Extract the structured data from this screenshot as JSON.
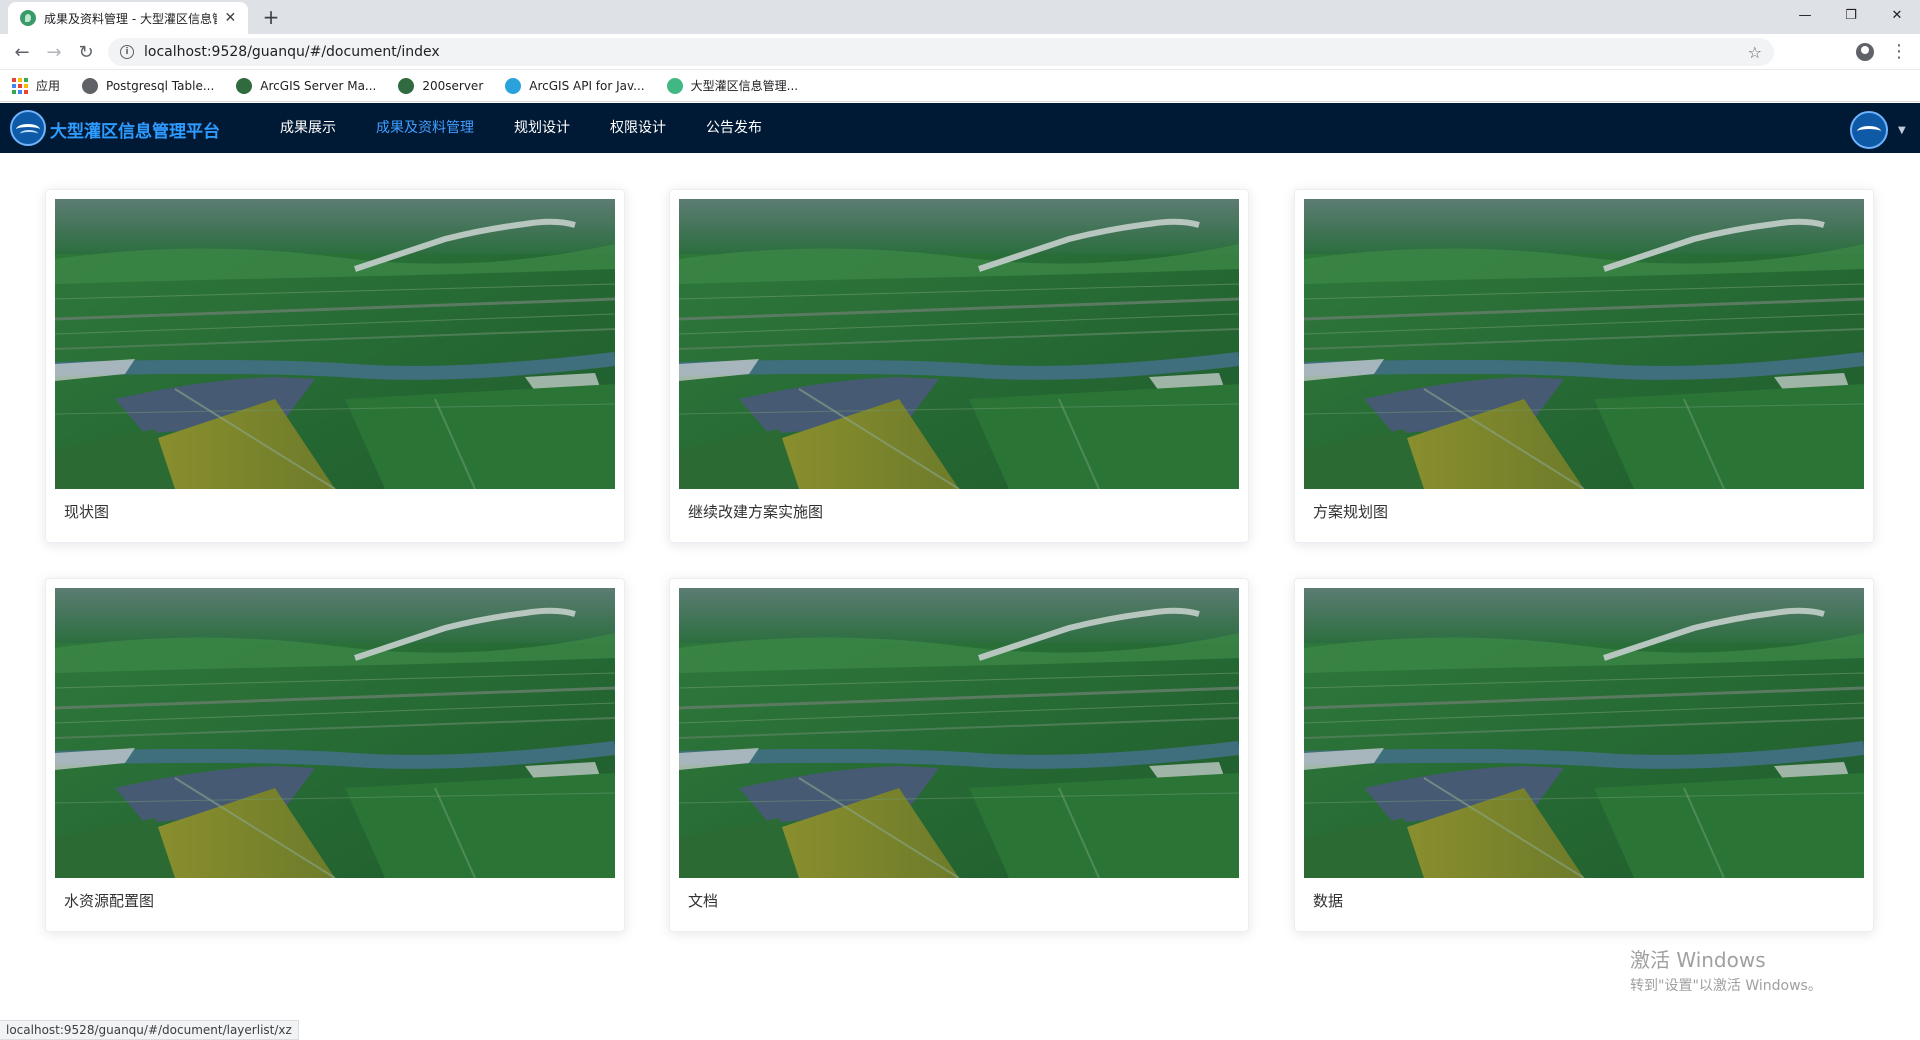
{
  "browser": {
    "tab_title": "成果及资料管理 - 大型灌区信息管",
    "tab_close": "✕",
    "new_tab": "+",
    "url": "localhost:9528/guanqu/#/document/index",
    "bookmarks": [
      {
        "label": "应用",
        "icon": "apps-grid",
        "color": "#ea4335"
      },
      {
        "label": "Postgresql Table...",
        "icon": "globe",
        "color": "#5f6368"
      },
      {
        "label": "ArcGIS Server Ma...",
        "icon": "globe",
        "color": "#2f6b3f"
      },
      {
        "label": "200server",
        "icon": "globe",
        "color": "#2f6b3f"
      },
      {
        "label": "ArcGIS API for Jav...",
        "icon": "arcgis",
        "color": "#2aa3dc"
      },
      {
        "label": "大型灌区信息管理...",
        "icon": "vue-leaf",
        "color": "#41b883"
      }
    ],
    "status_url": "localhost:9528/guanqu/#/document/layerlist/xz"
  },
  "app": {
    "brand": "大型灌区信息管理平台",
    "nav": [
      {
        "label": "成果展示",
        "active": false
      },
      {
        "label": "成果及资料管理",
        "active": true
      },
      {
        "label": "规划设计",
        "active": false
      },
      {
        "label": "权限设计",
        "active": false
      },
      {
        "label": "公告发布",
        "active": false
      }
    ],
    "accent_color": "#409eff",
    "header_color": "#001a35"
  },
  "cards": [
    {
      "title": "现状图"
    },
    {
      "title": "继续改建方案实施图"
    },
    {
      "title": "方案规划图"
    },
    {
      "title": "水资源配置图"
    },
    {
      "title": "文档"
    },
    {
      "title": "数据"
    }
  ],
  "watermark": {
    "title": "激活 Windows",
    "subtitle": "转到\"设置\"以激活 Windows。"
  }
}
